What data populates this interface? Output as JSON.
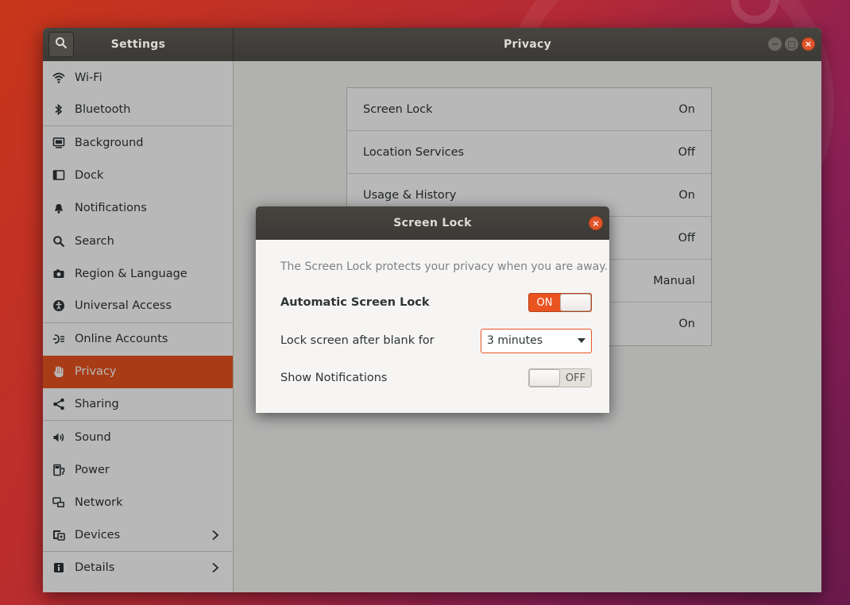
{
  "window": {
    "settings_title": "Settings",
    "panel_title": "Privacy",
    "controls": {
      "minimize": "−",
      "maximize": "□",
      "close": "×"
    }
  },
  "sidebar": {
    "items": [
      {
        "label": "Wi-Fi",
        "icon": "wifi-icon"
      },
      {
        "label": "Bluetooth",
        "icon": "bluetooth-icon"
      },
      {
        "label": "Background",
        "icon": "background-icon"
      },
      {
        "label": "Dock",
        "icon": "dock-icon"
      },
      {
        "label": "Notifications",
        "icon": "bell-icon"
      },
      {
        "label": "Search",
        "icon": "search-icon"
      },
      {
        "label": "Region & Language",
        "icon": "camera-icon"
      },
      {
        "label": "Universal Access",
        "icon": "accessibility-icon"
      },
      {
        "label": "Online Accounts",
        "icon": "online-accounts-icon"
      },
      {
        "label": "Privacy",
        "icon": "hand-icon",
        "active": true
      },
      {
        "label": "Sharing",
        "icon": "share-icon"
      },
      {
        "label": "Sound",
        "icon": "speaker-icon"
      },
      {
        "label": "Power",
        "icon": "power-icon"
      },
      {
        "label": "Network",
        "icon": "network-icon"
      },
      {
        "label": "Devices",
        "icon": "devices-icon",
        "chevron": true
      },
      {
        "label": "Details",
        "icon": "info-icon",
        "chevron": true
      }
    ]
  },
  "privacy": {
    "rows": [
      {
        "label": "Screen Lock",
        "value": "On"
      },
      {
        "label": "Location Services",
        "value": "Off"
      },
      {
        "label": "Usage & History",
        "value": "On"
      },
      {
        "label": "",
        "value": "Off"
      },
      {
        "label": "",
        "value": "Manual"
      },
      {
        "label": "",
        "value": "On"
      }
    ]
  },
  "dialog": {
    "title": "Screen Lock",
    "description": "The Screen Lock protects your privacy when you are away.",
    "auto_lock": {
      "label": "Automatic Screen Lock",
      "state": "ON"
    },
    "lock_after": {
      "label": "Lock screen after blank for",
      "selected": "3 minutes"
    },
    "show_notifications": {
      "label": "Show Notifications",
      "state": "OFF"
    }
  },
  "colors": {
    "accent": "#e95420",
    "headerbar": "#3b3a36",
    "close_button": "#e0552a"
  }
}
